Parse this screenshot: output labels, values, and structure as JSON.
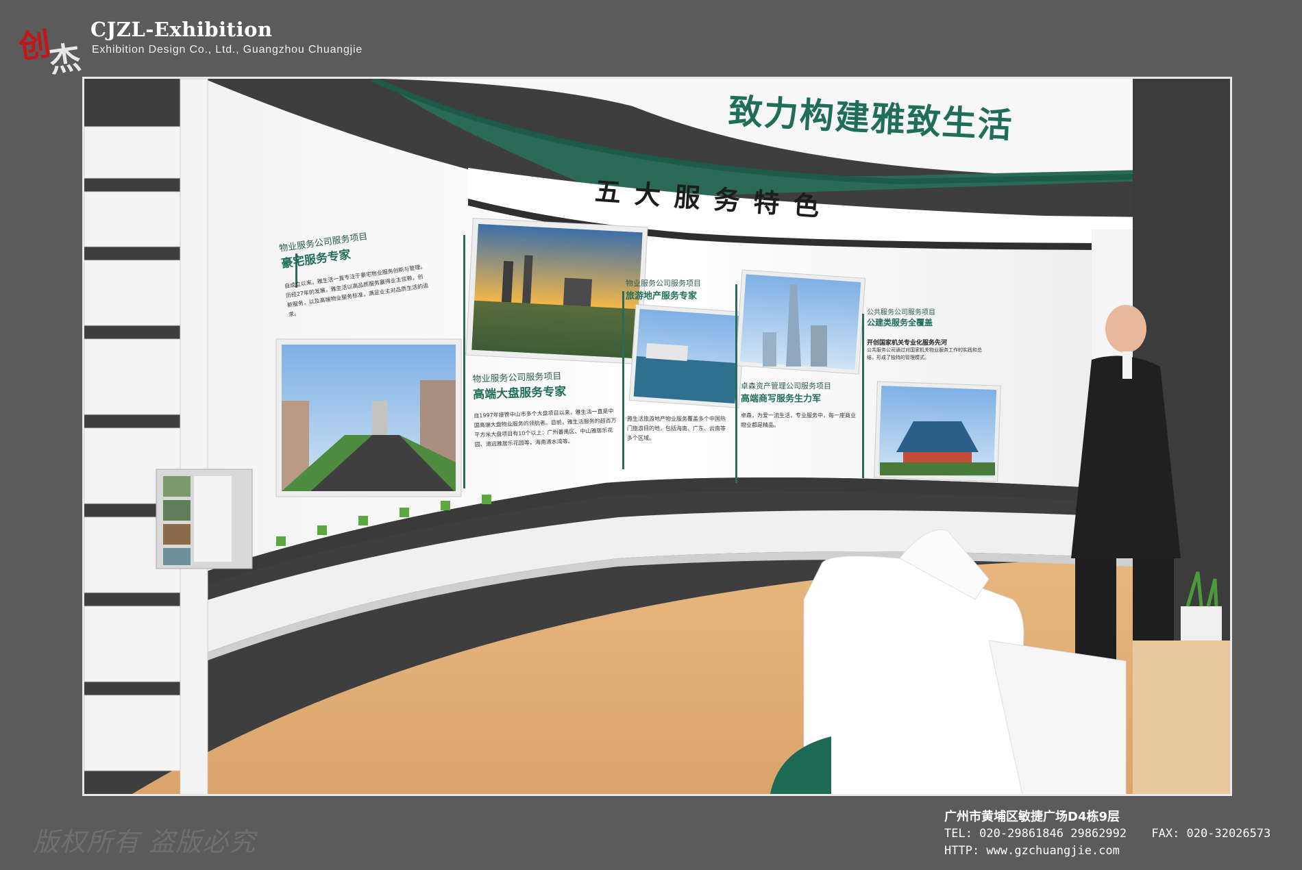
{
  "brand": {
    "logo_text": "创杰",
    "title": "CJZL-Exhibition",
    "subtitle": "Exhibition Design Co., Ltd., Guangzhou Chuangjie"
  },
  "scene": {
    "headline": "致力构建雅致生活",
    "section_title": "五大服务特色",
    "panels": [
      {
        "kicker": "物业服务公司服务项目",
        "heading": "豪宅服务专家",
        "body": "自成立以来，雅生活一直专注于豪宅物业服务创新与管理。历经27年的发展，雅生活以高品质服务赢得业主信赖，创新服务，以及高端物业服务标准，满足业主对品质生活的追求。"
      },
      {
        "kicker": "物业服务公司服务项目",
        "heading": "高端大盘服务专家",
        "body": "自1997年接管中山市多个大盘项目以来，雅生活一直是中国高端大盘物业服务的领航者。目前，雅生活服务的超百万平方米大盘项目有10个以上：广州番禺区、中山雅居乐花园、清远雅居乐花园等，海南清水湾等。"
      },
      {
        "kicker": "物业服务公司服务项目",
        "heading": "旅游地产服务专家",
        "body": "雅生活旅游地产物业服务覆盖多个中国热门旅游目的地，包括海南、广东、云南等多个区域。"
      },
      {
        "kicker": "卓森资产管理公司服务项目",
        "heading": "高端商写服务生力军",
        "body": "卓森，为爱一流生活，专业服务中，每一座商业物业都是精品。"
      },
      {
        "kicker": "公共服务公司服务项目",
        "heading": "公建类服务全覆盖",
        "subheading": "开创国家机关专业化服务先河",
        "body": "公共服务公司通过对国家机关物业服务工作的实践和总结，形成了独特的管理模式。"
      }
    ]
  },
  "footer": {
    "copyright": "版权所有 盗版必究",
    "address": "广州市黄埔区敏捷广场D4栋9层",
    "tel": "TEL: 020-29861846   29862992",
    "fax": "FAX: 020-32026573",
    "http": "HTTP: www.gzchuangjie.com"
  }
}
